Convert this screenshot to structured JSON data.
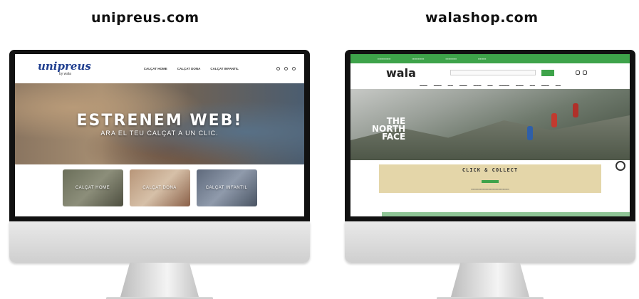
{
  "titles": {
    "left": "unipreus.com",
    "right": "walashop.com"
  },
  "unipreus": {
    "logo": "unipreus",
    "logo_sub": "by wala",
    "nav": [
      "CALÇAT HOME",
      "CALÇAT DONA",
      "CALÇAT INFANTIL"
    ],
    "hero_title": "ESTRENEM WEB!",
    "hero_subtitle": "ARA EL TEU CALÇAT A UN CLIC.",
    "categories": [
      "CALÇAT HOME",
      "CALÇAT DONA",
      "CALÇAT INFANTIL"
    ]
  },
  "wala": {
    "logo": "wala",
    "hero_brand": [
      "THE",
      "NORTH",
      "FACE"
    ],
    "cc_title": "CLICK & COLLECT"
  },
  "colors": {
    "wala_green": "#3ea34a",
    "unipreus_blue": "#1f3e8f"
  }
}
